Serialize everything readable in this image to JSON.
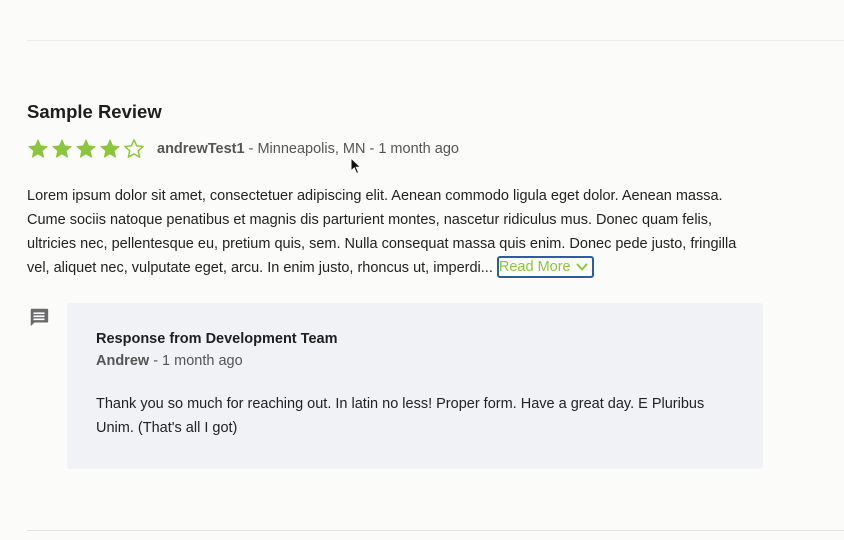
{
  "review": {
    "title": "Sample Review",
    "rating": 4,
    "max_rating": 5,
    "author": "andrewTest1",
    "location_time": " - Minneapolis, MN - 1 month ago",
    "body": "Lorem ipsum dolor sit amet, consectetuer adipiscing elit. Aenean commodo ligula eget dolor. Aenean massa. Cume sociis natoque penatibus et magnis dis parturient montes, nascetur ridiculus mus. Donec quam felis, ultricies nec, pellentesque eu, pretium quis, sem. Nulla consequat massa quis enim. Donec pede justo, fringilla vel, aliquet nec, vulputate eget, arcu. In enim justo, rhoncus ut, imperdi...",
    "read_more_label": "Read More"
  },
  "response": {
    "heading": "Response from Development Team",
    "author": "Andrew",
    "time": " - 1 month ago",
    "body": "Thank you so much for reaching out. In latin no less! Proper form. Have a great day. E Pluribus Unim. (That's all I got)"
  },
  "icons": {
    "star_filled": "star-filled-icon",
    "star_empty": "star-outline-icon",
    "chevron": "chevron-down-icon",
    "comment": "comment-icon",
    "cursor": "mouse-pointer"
  },
  "colors": {
    "accent_green": "#8cc63f",
    "focus_blue": "#2f5d9c",
    "response_bg": "#f1f2f6",
    "icon_gray": "#6b6b6b"
  }
}
